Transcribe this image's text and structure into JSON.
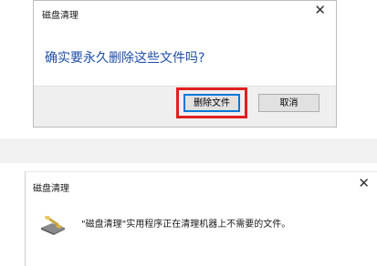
{
  "confirm_dialog": {
    "title": "磁盘清理",
    "close_glyph": "✕",
    "question": "确实要永久删除这些文件吗?",
    "delete_button_label": "删除文件",
    "cancel_button_label": "取消",
    "highlight_color": "#e02020",
    "footer_color": "#efefef",
    "question_color": "#1f4ea8"
  },
  "progress_dialog": {
    "title": "磁盘清理",
    "close_glyph": "✕",
    "icon": "disk-cleanup-icon",
    "message": "\"磁盘清理\"实用程序正在清理机器上不需要的文件。"
  }
}
